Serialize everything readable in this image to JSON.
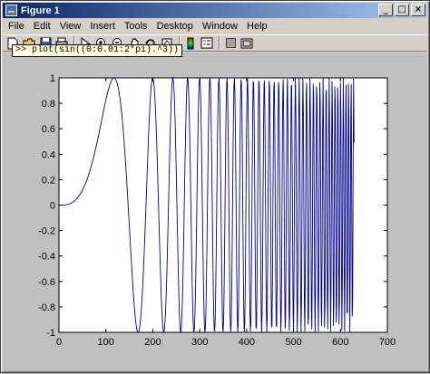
{
  "window": {
    "title": "Figure 1",
    "buttons": {
      "minimize": "_",
      "maximize": "□",
      "close": "×"
    }
  },
  "menu": [
    "File",
    "Edit",
    "View",
    "Insert",
    "Tools",
    "Desktop",
    "Window",
    "Help"
  ],
  "toolbar": {
    "icons": [
      "new-file-icon",
      "open-folder-icon",
      "save-icon",
      "print-icon",
      "arrow-pointer-icon",
      "zoom-in-icon",
      "zoom-out-icon",
      "pan-icon",
      "rotate-icon",
      "data-cursor-icon",
      "colorbar-icon",
      "legend-icon",
      "hide-plot-tools-icon",
      "show-plot-tools-icon"
    ]
  },
  "command": ">> plot(sin((0:0.01:2*pi).^3))",
  "chart_data": {
    "type": "line",
    "series": [
      {
        "expression": "sin((0:0.01:2*pi).^3)",
        "n_points": 629,
        "x_start": 1,
        "x_end": 629
      }
    ],
    "title": "",
    "xlabel": "",
    "ylabel": "",
    "xlim": [
      0,
      700
    ],
    "ylim": [
      -1,
      1
    ],
    "xticks": [
      "0",
      "100",
      "200",
      "300",
      "400",
      "500",
      "600",
      "700"
    ],
    "yticks": [
      "-1",
      "-0.8",
      "-0.6",
      "-0.4",
      "-0.2",
      "0",
      "0.2",
      "0.4",
      "0.6",
      "0.8",
      "1"
    ],
    "xtick_values": [
      0,
      100,
      200,
      300,
      400,
      500,
      600,
      700
    ],
    "ytick_values": [
      -1,
      -0.8,
      -0.6,
      -0.4,
      -0.2,
      0,
      0.2,
      0.4,
      0.6,
      0.8,
      1
    ],
    "grid": false,
    "line_color": "#00008b"
  }
}
